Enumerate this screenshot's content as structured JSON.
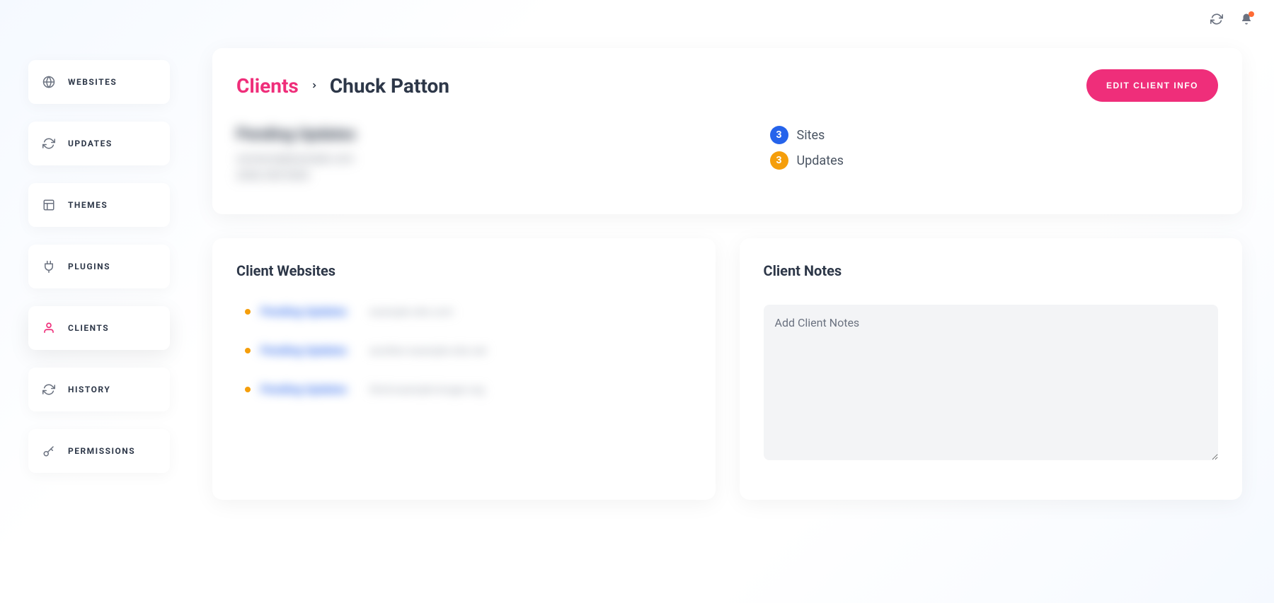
{
  "topbar": {},
  "sidebar": {
    "items": [
      {
        "label": "WEBSITES",
        "icon": "globe"
      },
      {
        "label": "UPDATES",
        "icon": "refresh"
      },
      {
        "label": "THEMES",
        "icon": "layout"
      },
      {
        "label": "PLUGINS",
        "icon": "plug"
      },
      {
        "label": "CLIENTS",
        "icon": "user",
        "active": true
      },
      {
        "label": "HISTORY",
        "icon": "refresh"
      },
      {
        "label": "PERMISSIONS",
        "icon": "key"
      }
    ]
  },
  "breadcrumb": {
    "root": "Clients",
    "current": "Chuck Patton"
  },
  "actions": {
    "edit_client": "EDIT CLIENT INFO"
  },
  "client": {
    "name_redacted": "Pending Updates",
    "email_redacted": "someone@example.com",
    "phone_redacted": "(555) 555-5555"
  },
  "stats": {
    "sites_count": "3",
    "sites_label": "Sites",
    "updates_count": "3",
    "updates_label": "Updates"
  },
  "panels": {
    "websites_title": "Client Websites",
    "notes_title": "Client Notes",
    "notes_placeholder": "Add Client Notes"
  },
  "websites": [
    {
      "name_redacted": "Pending Updates",
      "url_redacted": "example-site.com"
    },
    {
      "name_redacted": "Pending Updates",
      "url_redacted": "another-example-site.net"
    },
    {
      "name_redacted": "Pending Updates",
      "url_redacted": "third-example-longer.org"
    }
  ],
  "colors": {
    "accent_pink": "#ef2e7a",
    "badge_blue": "#2563eb",
    "badge_orange": "#f59e0b"
  }
}
